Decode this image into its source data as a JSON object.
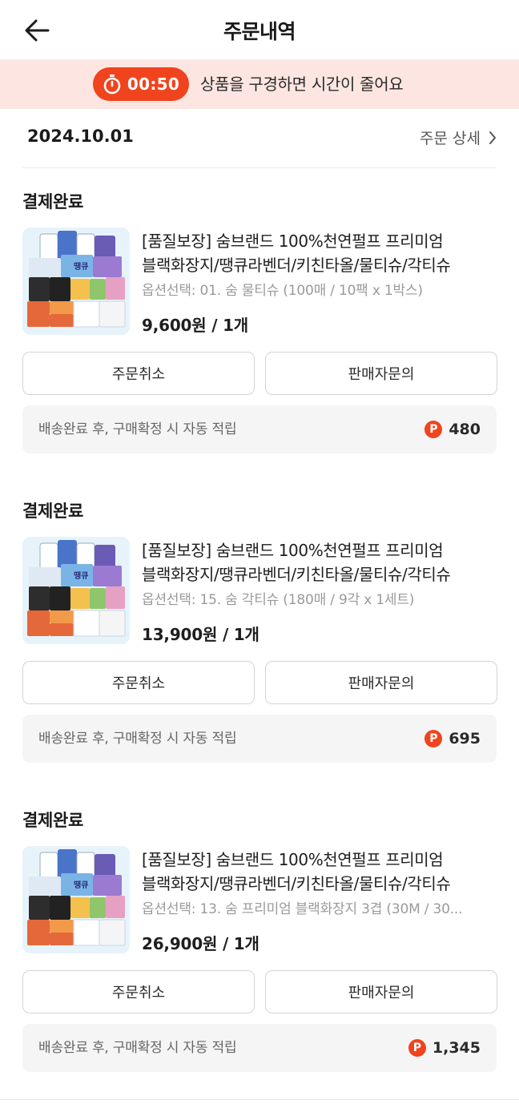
{
  "header": {
    "title": "주문내역",
    "back_icon": "arrow-left-icon"
  },
  "timer_banner": {
    "time": "00:50",
    "message": "상품을 구경하면 시간이 줄어요",
    "accent_color": "#f0441e",
    "background_color": "#fde6e1"
  },
  "order_group": {
    "date": "2024.10.01",
    "detail_link": "주문 상세"
  },
  "orders": [
    {
      "status": "결제완료",
      "title_line1": "[품질보장] 숨브랜드 100%천연펄프 프리미엄",
      "title_line2": "블랙화장지/땡큐라벤더/키친타올/물티슈/각티슈",
      "option": "옵션선택: 01. 숨 물티슈 (100매 / 10팩 x 1박스)",
      "price": "9,600원 / 1개",
      "cancel_label": "주문취소",
      "inquiry_label": "판매자문의",
      "point_message": "배송완료 후, 구매확정 시 자동 적립",
      "point_badge": "P",
      "points": "480"
    },
    {
      "status": "결제완료",
      "title_line1": "[품질보장] 숨브랜드 100%천연펄프 프리미엄",
      "title_line2": "블랙화장지/땡큐라벤더/키친타올/물티슈/각티슈",
      "option": "옵션선택: 15. 숨 각티슈 (180매 / 9각 x 1세트)",
      "price": "13,900원 / 1개",
      "cancel_label": "주문취소",
      "inquiry_label": "판매자문의",
      "point_message": "배송완료 후, 구매확정 시 자동 적립",
      "point_badge": "P",
      "points": "695"
    },
    {
      "status": "결제완료",
      "title_line1": "[품질보장] 숨브랜드 100%천연펄프 프리미엄",
      "title_line2": "블랙화장지/땡큐라벤더/키친타올/물티슈/각티슈",
      "option": "옵션선택: 13. 숨 프리미엄 블랙화장지 3겹 (30M / 30...",
      "price": "26,900원 / 1개",
      "cancel_label": "주문취소",
      "inquiry_label": "판매자문의",
      "point_message": "배송완료 후, 구매확정 시 자동 적립",
      "point_badge": "P",
      "points": "1,345"
    }
  ]
}
